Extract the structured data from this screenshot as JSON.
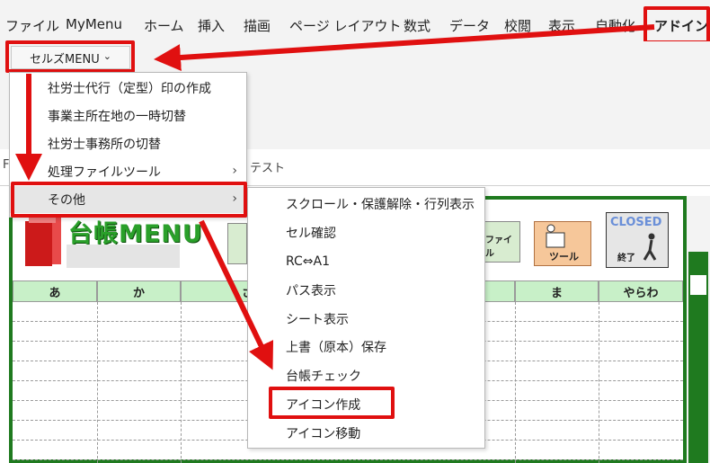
{
  "ribbon": {
    "tabs": [
      "ファイル",
      "MyMenu",
      "ホーム",
      "挿入",
      "描画",
      "ページ レイアウト",
      "数式",
      "データ",
      "校閲",
      "表示",
      "自動化",
      "アドイン"
    ],
    "addin_button": {
      "label": "セルズMENU",
      "chevron": "⌄"
    }
  },
  "formula_bar": {
    "left_char": "F",
    "fragment": "テスト"
  },
  "menu1": {
    "items": [
      {
        "label": "社労士代行（定型）印の作成",
        "submenu": false
      },
      {
        "label": "事業主所在地の一時切替",
        "submenu": false
      },
      {
        "label": "社労士事務所の切替",
        "submenu": false
      },
      {
        "label": "処理ファイルツール",
        "submenu": true
      },
      {
        "label": "その他",
        "submenu": true
      }
    ]
  },
  "menu2": {
    "items": [
      "スクロール・保護解除・行列表示",
      "セル確認",
      "RC⇔A1",
      "パス表示",
      "シート表示",
      "上書（原本）保存",
      "台帳チェック",
      "アイコン作成",
      "アイコン移動"
    ]
  },
  "sheet": {
    "banner_title": "台帳MENU",
    "btn_file": "ファイル",
    "btn_tool": "ツール",
    "btn_closed": "CLOSED",
    "btn_closed_sub": "終了",
    "columns": [
      "あ",
      "か",
      "さ",
      "ま",
      "やらわ"
    ]
  },
  "colors": {
    "highlight": "#e01010",
    "sheet_border": "#1f7a1f",
    "header_fill": "#c8f0c8"
  }
}
